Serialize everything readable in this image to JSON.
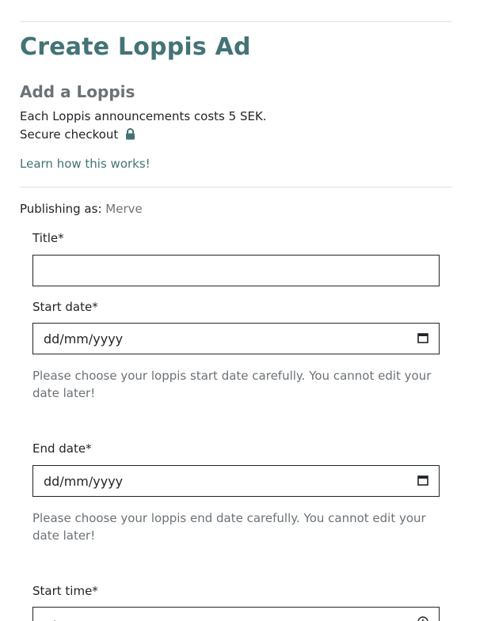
{
  "page_title": "Create Loppis Ad",
  "section_title": "Add a Loppis",
  "cost_text": "Each Loppis announcements costs 5 SEK.",
  "checkout_text": "Secure checkout",
  "learn_link": "Learn how this works!",
  "publishing": {
    "label": "Publishing as:",
    "user": "Merve"
  },
  "form": {
    "title_label": "Title*",
    "title_value": "",
    "start_date_label": "Start date*",
    "start_date_value": "dd/mm/yyyy",
    "start_date_help": "Please choose your loppis start date carefully. You cannot edit your date later!",
    "end_date_label": "End date*",
    "end_date_value": "dd/mm/yyyy",
    "end_date_help": "Please choose your loppis end date carefully. You cannot edit your date later!",
    "start_time_label": "Start time*",
    "start_time_value": "--:--"
  },
  "icons": {
    "lock": "lock-icon",
    "calendar": "calendar-icon",
    "clock": "clock-icon"
  },
  "colors": {
    "accent": "#437377",
    "muted": "#6c7277",
    "text": "#212529"
  }
}
